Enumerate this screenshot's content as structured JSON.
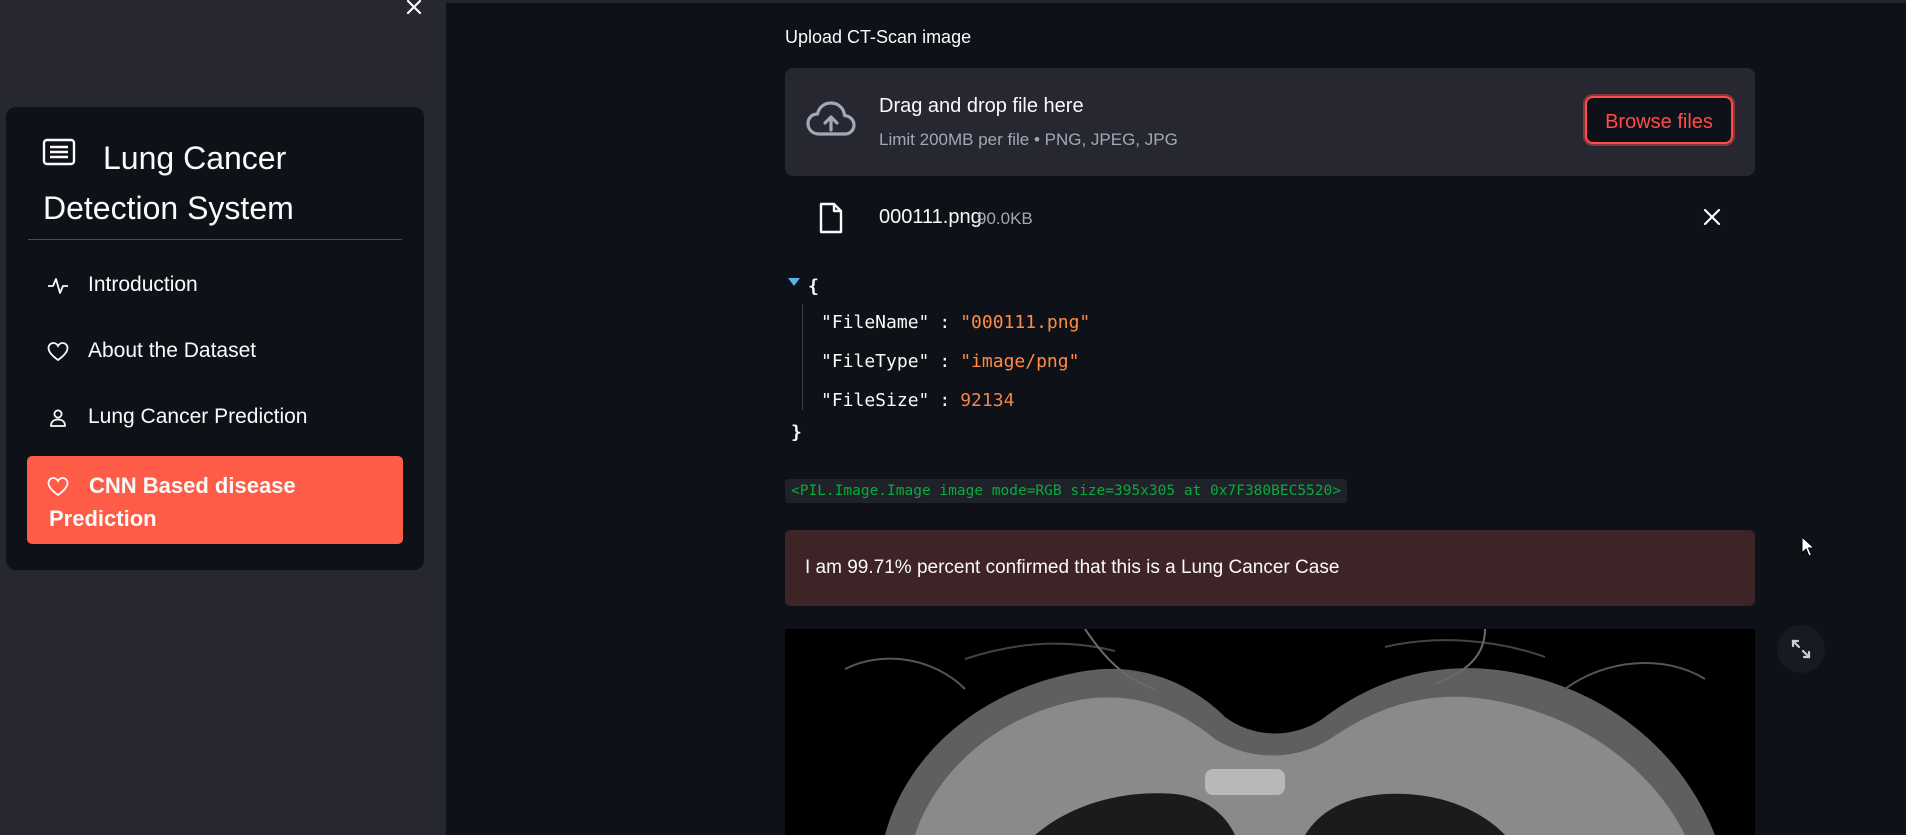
{
  "sidebar": {
    "close_icon": "close-icon",
    "menu": {
      "title": "Lung Cancer Detection System",
      "title_icon": "list-card-icon",
      "items": [
        {
          "label": "Introduction",
          "icon": "activity-icon",
          "active": false
        },
        {
          "label": "About the Dataset",
          "icon": "heart-icon",
          "active": false
        },
        {
          "label": "Lung Cancer Prediction",
          "icon": "person-icon",
          "active": false
        },
        {
          "label": "CNN Based disease Prediction",
          "icon": "heart-icon",
          "active": true
        }
      ]
    }
  },
  "main": {
    "upload_label": "Upload CT-Scan image",
    "dropzone": {
      "title": "Drag and drop file here",
      "limit": "Limit 200MB per file • PNG, JPEG, JPG",
      "browse_label": "Browse files",
      "icon": "cloud-upload-icon"
    },
    "file": {
      "name": "000111.png",
      "size": "90.0KB",
      "icon": "file-icon"
    },
    "json_view": {
      "open_brace": "{",
      "close_brace": "}",
      "entries": [
        {
          "key": "\"FileName\"",
          "value": "\"000111.png\""
        },
        {
          "key": "\"FileType\"",
          "value": "\"image/png\""
        },
        {
          "key": "\"FileSize\"",
          "value": "92134"
        }
      ]
    },
    "pil_repr": "<PIL.Image.Image image mode=RGB size=395x305 at 0x7F380BEC5520>",
    "result_message": "I am 99.71% percent confirmed that this is a Lung Cancer Case",
    "image_toolbar": {
      "fullscreen_icon": "fullscreen-icon"
    }
  },
  "colors": {
    "app_background": "#0e1117",
    "sidebar_background": "#262730",
    "accent": "#ff4b4b",
    "active_menu": "#ff5c47",
    "error_box": "#3e2426"
  }
}
